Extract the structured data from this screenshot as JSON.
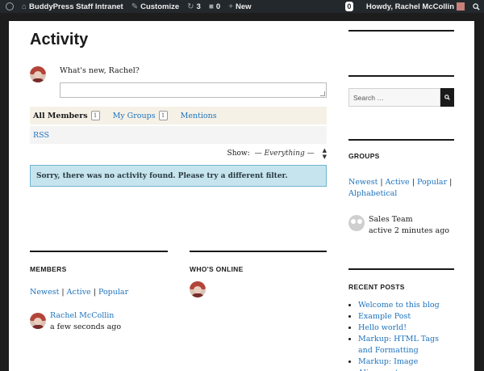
{
  "adminbar": {
    "site_name": "BuddyPress Staff Intranet",
    "customize": "Customize",
    "updates_count": "3",
    "comments_count": "0",
    "new_label": "New",
    "notifications_count": "0",
    "howdy": "Howdy, Rachel McCollin"
  },
  "main": {
    "title": "Activity",
    "whats_new": "What's new, Rachel?",
    "tabs": [
      {
        "label": "All Members",
        "count": "1"
      },
      {
        "label": "My Groups",
        "count": "1"
      },
      {
        "label": "Mentions"
      }
    ],
    "rss": "RSS",
    "show_label": "Show:",
    "show_value": "— Everything —",
    "notice": "Sorry, there was no activity found. Please try a different filter."
  },
  "members_widget": {
    "title": "MEMBERS",
    "filters": [
      "Newest",
      "Active",
      "Popular"
    ],
    "member_name": "Rachel McCollin",
    "member_time": "a few seconds ago"
  },
  "whos_online": {
    "title": "WHO'S ONLINE"
  },
  "sidebar": {
    "search_placeholder": "Search …",
    "groups_title": "GROUPS",
    "group_filters": [
      "Newest",
      "Active",
      "Popular",
      "Alphabetical"
    ],
    "group_name": "Sales Team",
    "group_time": "active 2 minutes ago",
    "recent_title": "RECENT POSTS",
    "recent_posts": [
      "Welcome to this blog",
      "Example Post",
      "Hello world!",
      "Markup: HTML Tags and Formatting",
      "Markup: Image Alignment"
    ]
  },
  "colors": {
    "link": "#1e73be",
    "adminbar": "#23282d",
    "notice_bg": "#c6e4ee",
    "notice_border": "#6fb4cf",
    "filter_bg": "#f5f1e6"
  }
}
